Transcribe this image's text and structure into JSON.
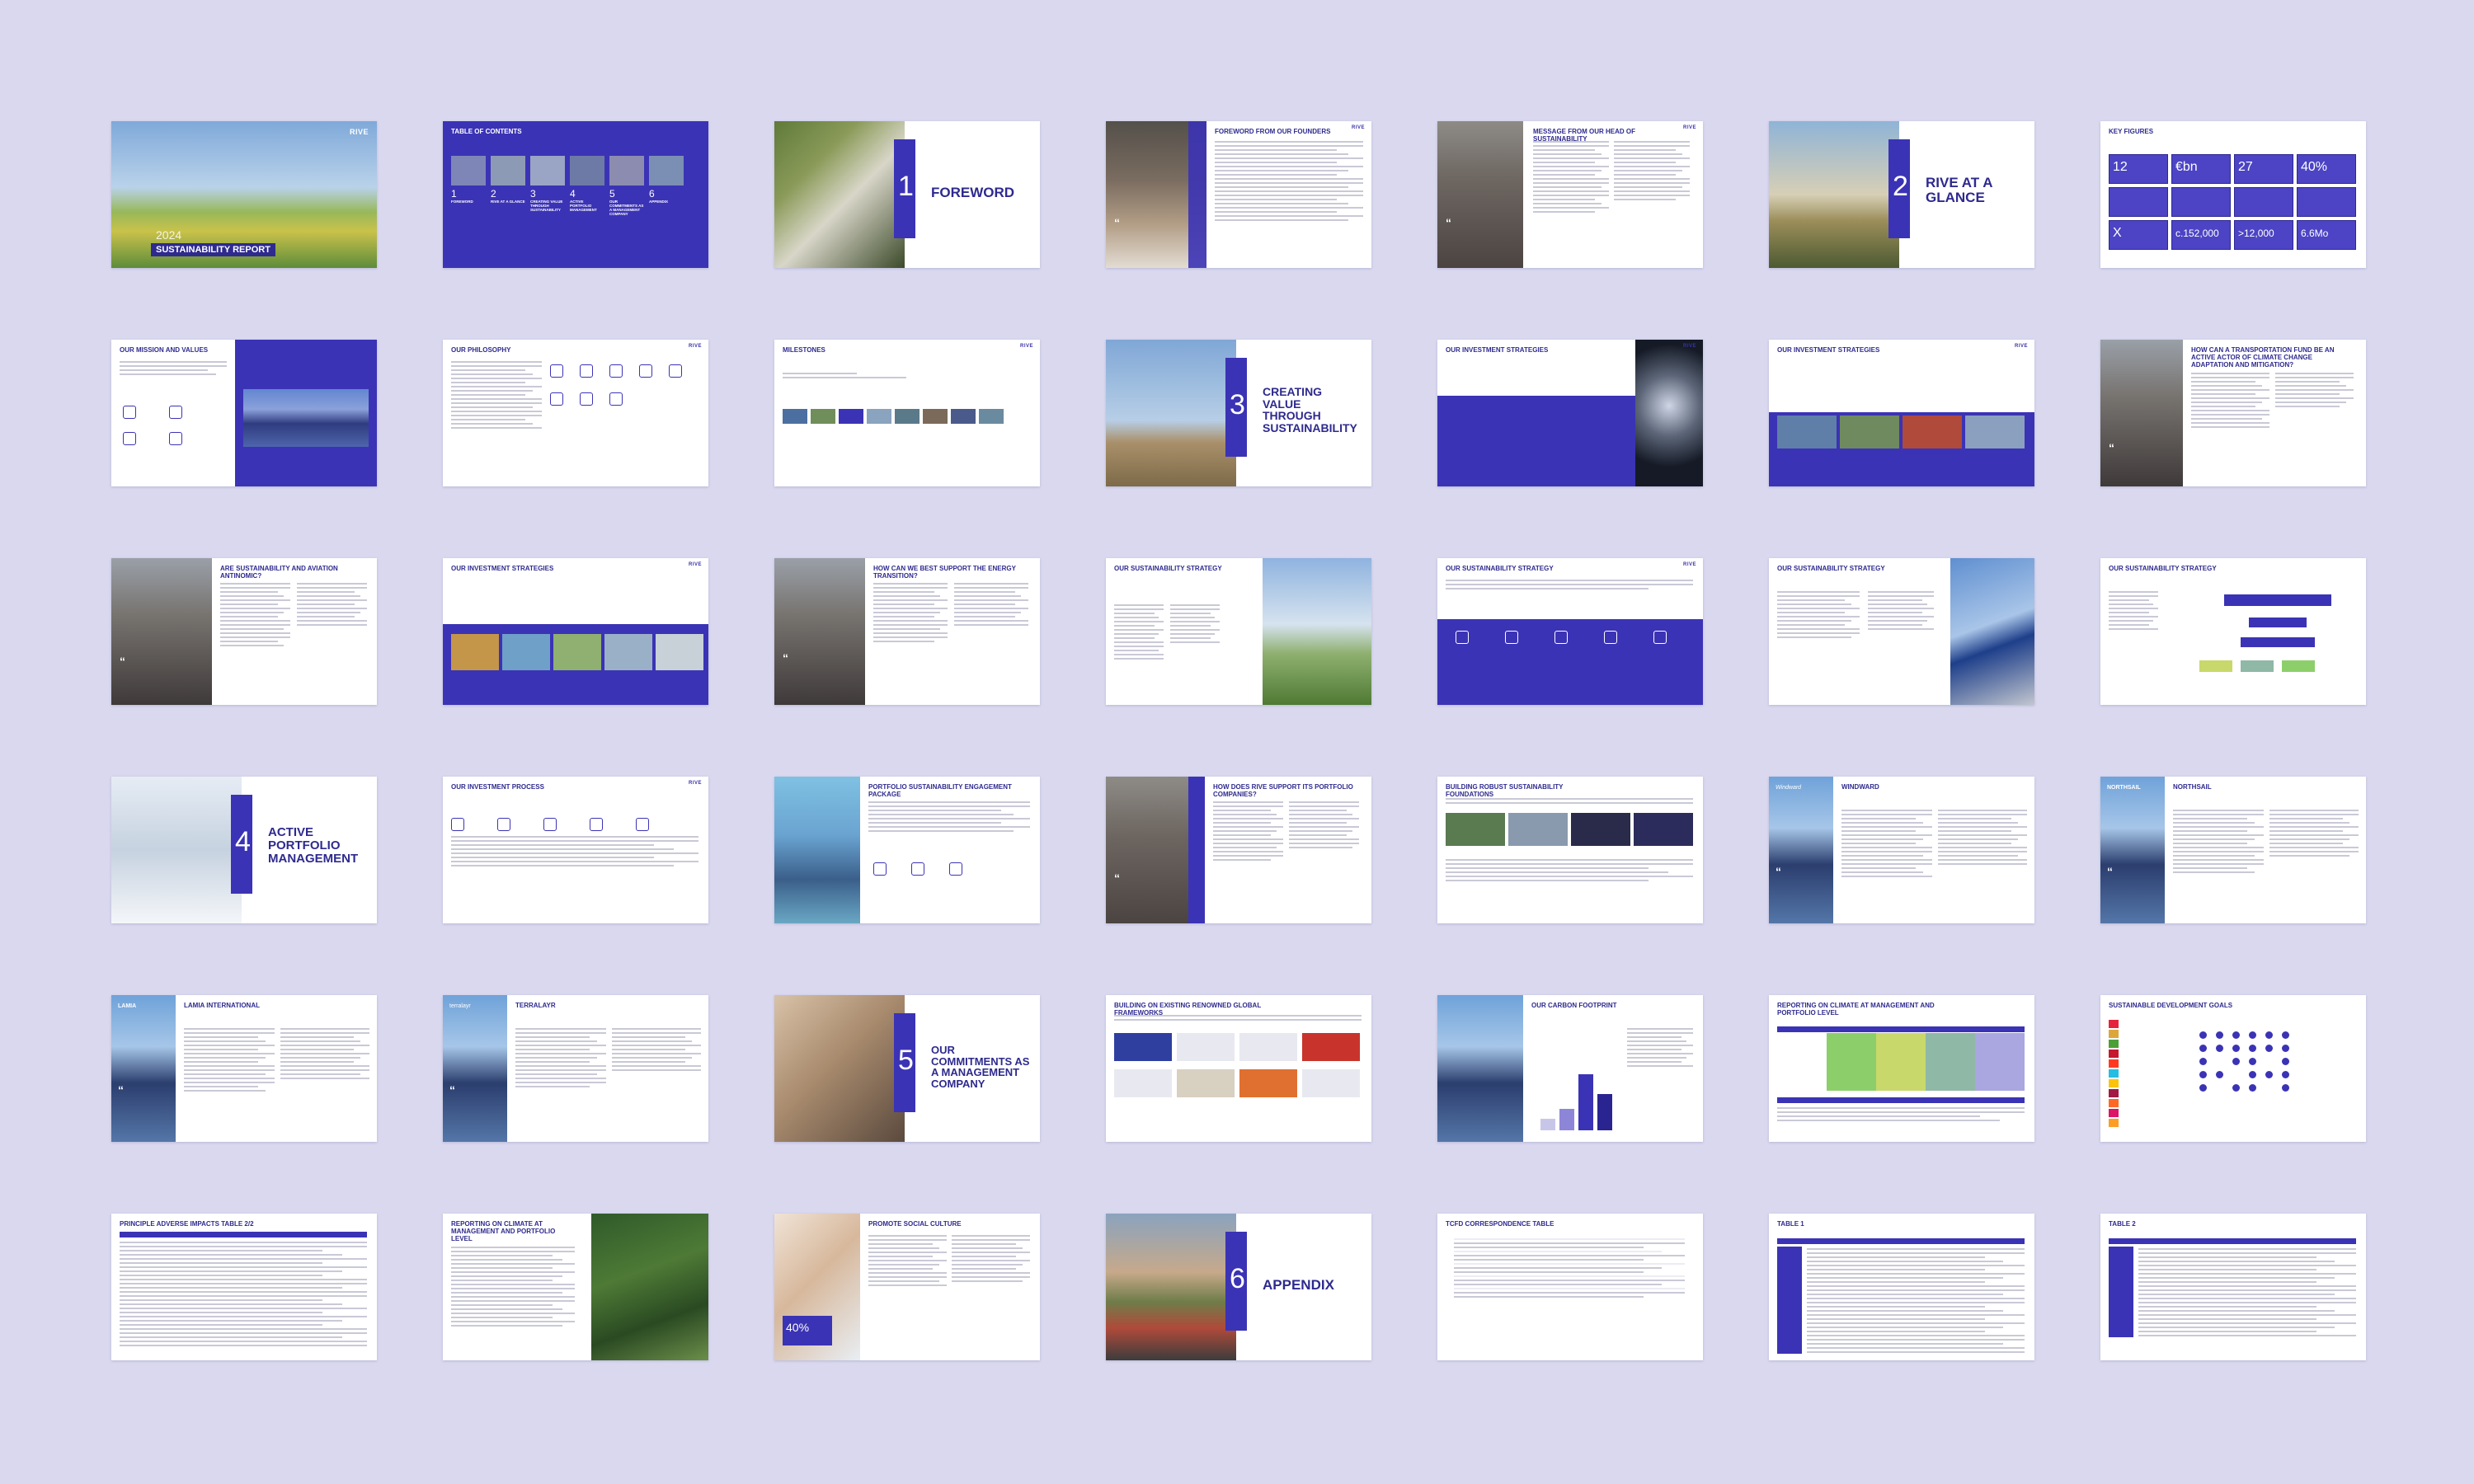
{
  "pages": [
    {
      "title": "Sustainability Report",
      "year": "2024",
      "brand": "RIVE"
    },
    {
      "title": "Table of Contents",
      "toc": [
        {
          "n": "1",
          "label": "FOREWORD"
        },
        {
          "n": "2",
          "label": "RIVE AT A GLANCE"
        },
        {
          "n": "3",
          "label": "CREATING VALUE THROUGH SUSTAINABILITY"
        },
        {
          "n": "4",
          "label": "ACTIVE PORTFOLIO MANAGEMENT"
        },
        {
          "n": "5",
          "label": "OUR COMMITMENTS AS A MANAGEMENT COMPANY"
        },
        {
          "n": "6",
          "label": "APPENDIX"
        }
      ]
    },
    {
      "num": "1",
      "chapter": "FOREWORD"
    },
    {
      "title": "Foreword from our founders"
    },
    {
      "title": "Message from our head of sustainability"
    },
    {
      "num": "2",
      "chapter": "RIVE AT A GLANCE"
    },
    {
      "title": "Key figures",
      "figures": [
        "12",
        "€bn",
        "27",
        "40%",
        "X",
        "c.152,000",
        ">12,000",
        "6.6Mo"
      ]
    },
    {
      "title": "Our mission and values"
    },
    {
      "title": "Our philosophy"
    },
    {
      "title": "Milestones"
    },
    {
      "num": "3",
      "chapter": "CREATING VALUE THROUGH SUSTAINABILITY"
    },
    {
      "title": "Our investment strategies"
    },
    {
      "title": "Our investment strategies"
    },
    {
      "title": "How can a transportation fund be an active actor of climate change adaptation and mitigation?"
    },
    {
      "title": "Are sustainability and aviation antinomic?"
    },
    {
      "title": "Our investment strategies"
    },
    {
      "title": "How can we best support the energy transition?"
    },
    {
      "title": "Our sustainability strategy"
    },
    {
      "title": "Our sustainability strategy"
    },
    {
      "title": "Our sustainability strategy"
    },
    {
      "title": "Our sustainability strategy"
    },
    {
      "num": "4",
      "chapter": "ACTIVE PORTFOLIO MANAGEMENT"
    },
    {
      "title": "Our investment process"
    },
    {
      "title": "Portfolio sustainability engagement package"
    },
    {
      "title": "How does RIVE support its portfolio companies?"
    },
    {
      "title": "Building robust sustainability foundations"
    },
    {
      "title": "Windward",
      "tag": "Windward"
    },
    {
      "title": "Northsail",
      "tag": "NORTHSAIL"
    },
    {
      "title": "Lamia International",
      "tag": "LAMIA"
    },
    {
      "title": "Terralayr",
      "tag": "terralayr"
    },
    {
      "num": "5",
      "chapter": "OUR COMMITMENTS AS A MANAGEMENT COMPANY"
    },
    {
      "title": "Building on existing renowned global frameworks"
    },
    {
      "title": "Our carbon footprint"
    },
    {
      "title": "Reporting on climate at management and portfolio level"
    },
    {
      "title": "Sustainable development goals"
    },
    {
      "title": "Principle adverse impacts table 2/2"
    },
    {
      "title": "Reporting on climate at management and portfolio level"
    },
    {
      "title": "Promote social culture",
      "stat": "40%"
    },
    {
      "num": "6",
      "chapter": "APPENDIX"
    },
    {
      "title": "TCFD correspondence table"
    },
    {
      "title": "Table 1"
    },
    {
      "title": "Table 2"
    }
  ]
}
